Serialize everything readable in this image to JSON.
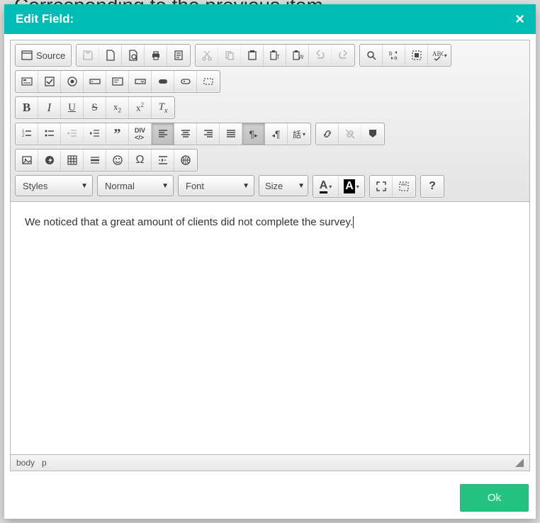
{
  "modal": {
    "title": "Edit Field:",
    "close_icon": "×"
  },
  "toolbar": {
    "source_label": "Source",
    "styles_label": "Styles",
    "format_label": "Normal",
    "font_label": "Font",
    "size_label": "Size",
    "text_A": "A",
    "help_label": "?"
  },
  "content": {
    "text": "We noticed that a great amount of clients did not complete the survey."
  },
  "pathbar": {
    "body": "body",
    "p": "p"
  },
  "footer": {
    "ok_label": "Ok"
  }
}
